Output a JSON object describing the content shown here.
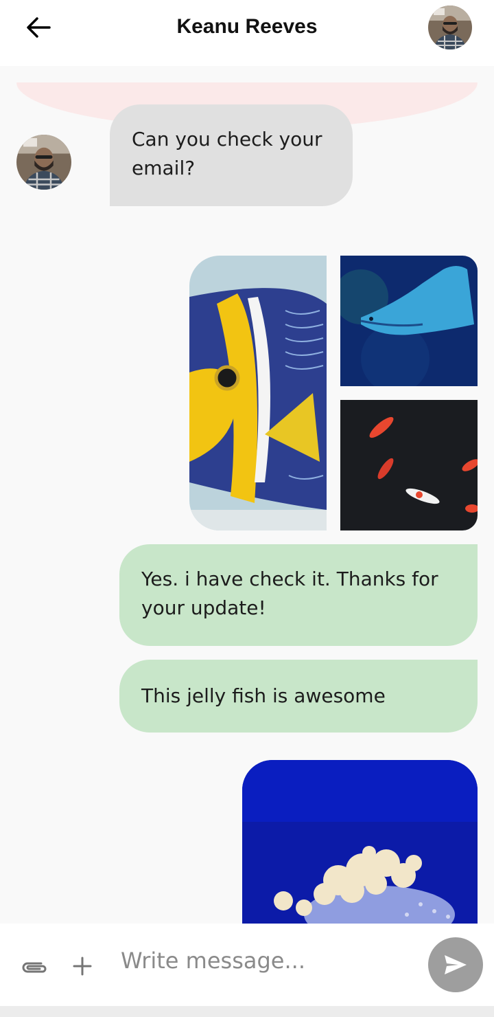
{
  "header": {
    "back_icon": "arrow-left-icon",
    "title": "Keanu Reeves",
    "avatar_icon": "contact-avatar"
  },
  "messages": [
    {
      "direction": "incoming",
      "type": "text",
      "text": "Can you check your email?"
    },
    {
      "direction": "outgoing",
      "type": "image-group",
      "images": [
        "fish-photo",
        "manta-ray-photo",
        "koi-fish-photo"
      ]
    },
    {
      "direction": "outgoing",
      "type": "text",
      "text": "Yes. i have check it. Thanks for your update!"
    },
    {
      "direction": "outgoing",
      "type": "text",
      "text": "This jelly fish is awesome"
    },
    {
      "direction": "outgoing",
      "type": "image",
      "image": "jellyfish-photo"
    }
  ],
  "composer": {
    "placeholder": "Write message...",
    "attach_icon": "paperclip-icon",
    "add_icon": "plus-icon",
    "send_icon": "send-icon"
  },
  "colors": {
    "incoming_bubble": "#e0e0e0",
    "outgoing_bubble": "#c8e6c9",
    "send_button": "#9e9e9e",
    "background": "#f9f9f9"
  }
}
